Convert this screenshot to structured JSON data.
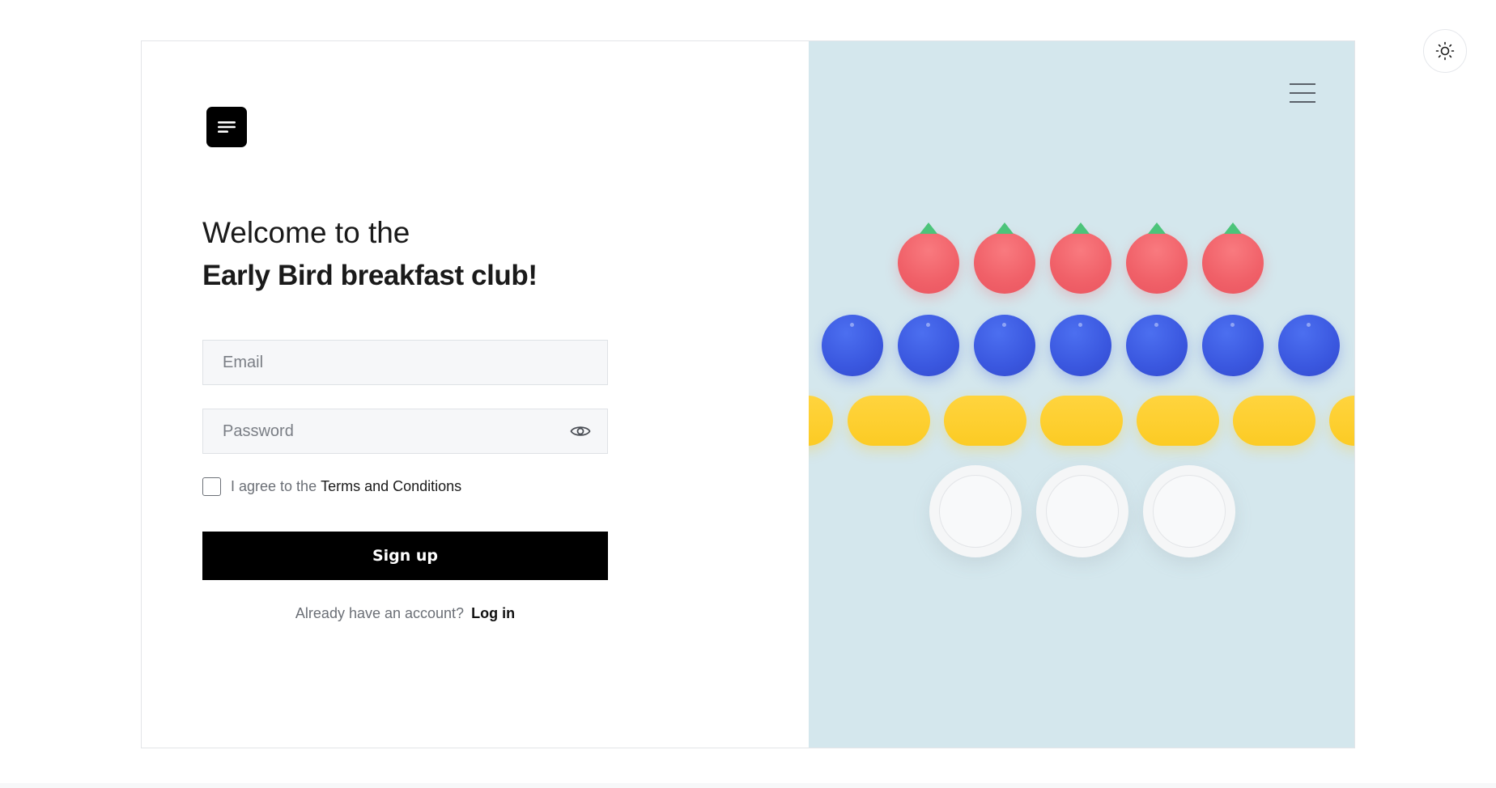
{
  "theme_toggle": {
    "icon": "sun-icon"
  },
  "logo": {
    "icon": "menu-lines-icon"
  },
  "heading": {
    "line1": "Welcome to the",
    "line2": "Early Bird breakfast club!"
  },
  "form": {
    "email": {
      "placeholder": "Email",
      "value": ""
    },
    "password": {
      "placeholder": "Password",
      "value": ""
    },
    "agree": {
      "prefix": "I agree to the",
      "link": "Terms and Conditions",
      "checked": false
    },
    "submit_label": "Sign up",
    "login_prompt": "Already have an account?",
    "login_link": "Log in"
  },
  "illustration": {
    "menu_icon": "hamburger-icon",
    "rows": [
      {
        "item": "tomato",
        "count": 5,
        "color": "#f06068"
      },
      {
        "item": "blueberry",
        "count": 7,
        "color": "#3a57df"
      },
      {
        "item": "pill",
        "count": 7,
        "color": "#fccb24"
      },
      {
        "item": "plate",
        "count": 3,
        "color": "#f5f6f7"
      }
    ]
  },
  "colors": {
    "accent": "#000000",
    "illustration_bg": "#d4e7ed",
    "field_bg": "#f6f7f9"
  }
}
